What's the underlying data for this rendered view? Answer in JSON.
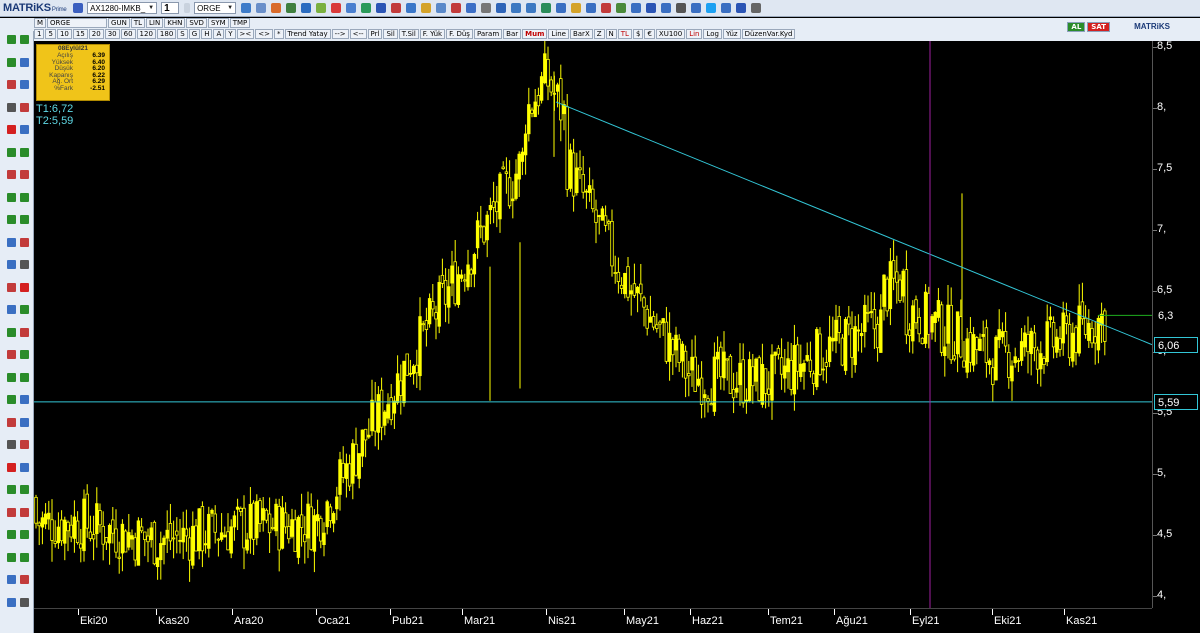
{
  "app": {
    "logo": "MATRiKS",
    "logo_sub": "Prime"
  },
  "toolbar": {
    "layout_combo": "AX1280-IMKB_",
    "page_number": "1",
    "symbol_combo": "ORGE",
    "matriks_label": "MATRiKS",
    "al_label": "AL",
    "sat_label": "SAT",
    "period_tabs_row1": [
      "M",
      "ORGE",
      "GUN",
      "TL",
      "LIN",
      "KHN",
      "SVD",
      "SYM",
      "TMP"
    ],
    "period_tabs_row2": [
      "1",
      "5",
      "10",
      "15",
      "20",
      "30",
      "60",
      "120",
      "180",
      "S",
      "G",
      "H",
      "A",
      "Y"
    ],
    "tools_row": [
      "><",
      "<>",
      "*",
      "Trend Yatay",
      "-->",
      "<--",
      "Prl",
      "Sil",
      "T.Sil",
      "F. Yük",
      "F. Düş",
      "Param",
      "Bar",
      "Mum",
      "Line",
      "BarX",
      "Z",
      "N",
      "TL",
      "$",
      "€",
      "XU100",
      "Lin",
      "Log",
      "Yüz",
      "DüzenVar.Kyd"
    ],
    "active_tab": "Mum"
  },
  "info_panel": {
    "date": "08Eylül21",
    "rows": [
      {
        "k": "Açılış",
        "v": "6.39"
      },
      {
        "k": "Yüksek",
        "v": "6.40"
      },
      {
        "k": "Düşük",
        "v": "6.20"
      },
      {
        "k": "Kapanış",
        "v": "6.22"
      },
      {
        "k": "Ağ. Ort",
        "v": "6.29"
      },
      {
        "k": "%Fark",
        "v": "-2.51"
      }
    ]
  },
  "trend_labels": {
    "t1": "T1:6,72",
    "t2": "T2:5,59"
  },
  "y_axis": {
    "ticks": [
      "8,5",
      "8,",
      "7,5",
      "7,",
      "6,5",
      "6,",
      "5,5",
      "5,",
      "4,5",
      "4,"
    ],
    "price_boxes": [
      {
        "value": "6,3",
        "kind": "last"
      },
      {
        "value": "6,06",
        "kind": "trend"
      },
      {
        "value": "5,59",
        "kind": "support"
      }
    ]
  },
  "x_axis": {
    "months": [
      "Eki20",
      "Kas20",
      "Ara20",
      "Oca21",
      "Pub21",
      "Mar21",
      "Nis21",
      "May21",
      "Haz21",
      "Tem21",
      "Ağu21",
      "Eyl21",
      "Eki21",
      "Kas21"
    ]
  },
  "chart_data": {
    "type": "candlestick",
    "symbol": "ORGE",
    "ylim": [
      3.9,
      8.55
    ],
    "x": [
      "Eki20",
      "Kas20",
      "Ara20",
      "Oca21",
      "Pub21",
      "Mar21",
      "Nis21",
      "May21",
      "Haz21",
      "Tem21",
      "Ağu21",
      "Eyl21",
      "Eki21",
      "Kas21"
    ],
    "approx_close_by_month_start": [
      4.6,
      4.45,
      4.55,
      4.6,
      5.65,
      6.7,
      7.9,
      6.6,
      5.8,
      5.75,
      6.05,
      6.35,
      5.95,
      6.1
    ],
    "last_close": 6.3,
    "support_level": 5.59,
    "trendline": {
      "start": {
        "x": "Nis21",
        "y": 8.05
      },
      "end": {
        "x": "Kas21",
        "y": 6.06
      }
    },
    "highlight_date": "08Eylül21",
    "colors": {
      "candle": "#ffff00",
      "trendline": "#33c6d6",
      "support": "#33c6d6",
      "cursor": "#a020a0"
    }
  }
}
